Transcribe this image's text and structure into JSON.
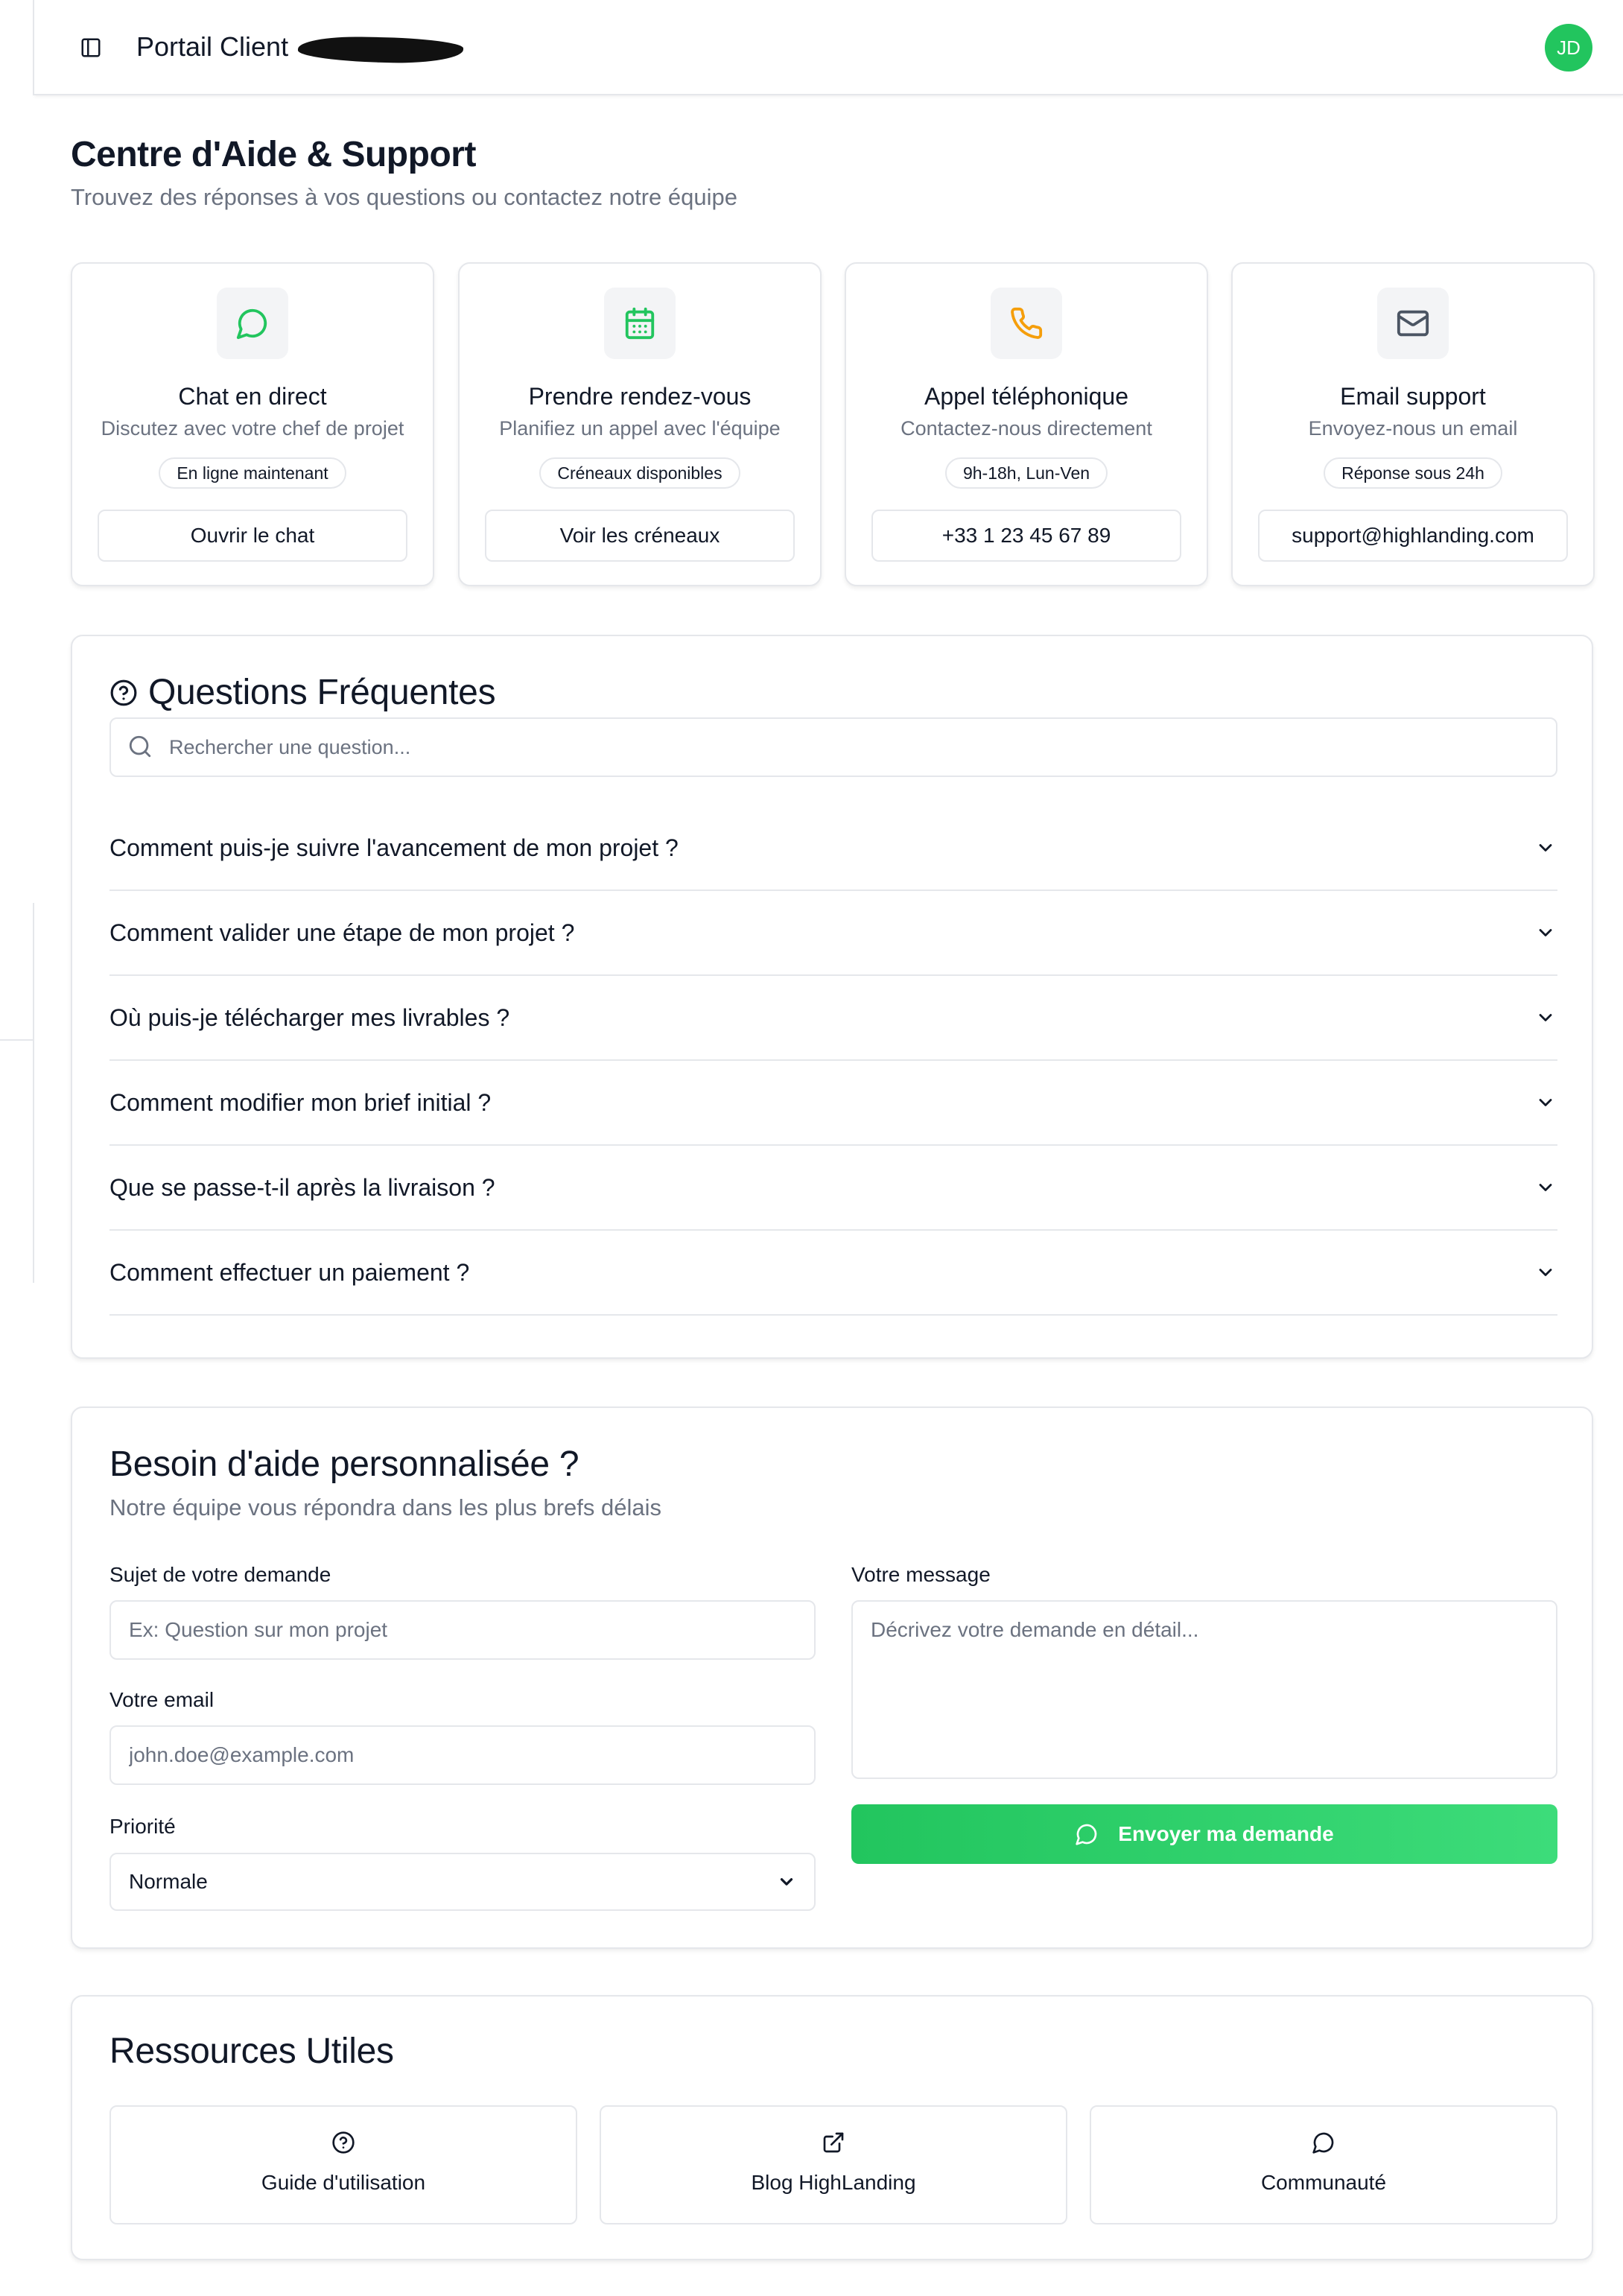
{
  "header": {
    "app_title": "Portail Client",
    "avatar_initials": "JD"
  },
  "page": {
    "title": "Centre d'Aide & Support",
    "subtitle": "Trouvez des réponses à vos questions ou contactez notre équipe"
  },
  "contact_cards": [
    {
      "icon": "chat-bubble-icon",
      "icon_color": "#22c55e",
      "title": "Chat en direct",
      "description": "Discutez avec votre chef de projet",
      "badge": "En ligne maintenant",
      "button": "Ouvrir le chat"
    },
    {
      "icon": "calendar-icon",
      "icon_color": "#22c55e",
      "title": "Prendre rendez-vous",
      "description": "Planifiez un appel avec l'équipe",
      "badge": "Créneaux disponibles",
      "button": "Voir les créneaux"
    },
    {
      "icon": "phone-icon",
      "icon_color": "#f59e0b",
      "title": "Appel téléphonique",
      "description": "Contactez-nous directement",
      "badge": "9h-18h, Lun-Ven",
      "button": "+33 1 23 45 67 89"
    },
    {
      "icon": "mail-icon",
      "icon_color": "#4b5563",
      "title": "Email support",
      "description": "Envoyez-nous un email",
      "badge": "Réponse sous 24h",
      "button": "support@highlanding.com"
    }
  ],
  "faq": {
    "title": "Questions Fréquentes",
    "search_placeholder": "Rechercher une question...",
    "items": [
      "Comment puis-je suivre l'avancement de mon projet ?",
      "Comment valider une étape de mon projet ?",
      "Où puis-je télécharger mes livrables ?",
      "Comment modifier mon brief initial ?",
      "Que se passe-t-il après la livraison ?",
      "Comment effectuer un paiement ?"
    ]
  },
  "form": {
    "title": "Besoin d'aide personnalisée ?",
    "subtitle": "Notre équipe vous répondra dans les plus brefs délais",
    "subject_label": "Sujet de votre demande",
    "subject_placeholder": "Ex: Question sur mon projet",
    "email_label": "Votre email",
    "email_placeholder": "john.doe@example.com",
    "priority_label": "Priorité",
    "priority_value": "Normale",
    "message_label": "Votre message",
    "message_placeholder": "Décrivez votre demande en détail...",
    "submit_label": "Envoyer ma demande"
  },
  "resources": {
    "title": "Ressources Utiles",
    "items": [
      {
        "icon": "help-circle-icon",
        "label": "Guide d'utilisation"
      },
      {
        "icon": "external-link-icon",
        "label": "Blog HighLanding"
      },
      {
        "icon": "chat-bubble-icon",
        "label": "Communauté"
      }
    ]
  },
  "colors": {
    "accent": "#22c55e",
    "border": "#e5e7eb",
    "muted_text": "#6b7280",
    "phone_icon": "#f59e0b"
  }
}
